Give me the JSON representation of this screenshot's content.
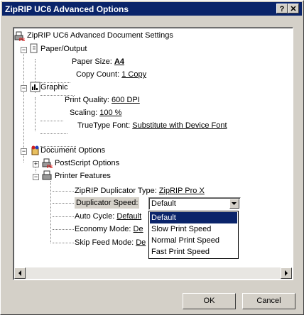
{
  "window": {
    "title": "ZipRIP UC6 Advanced Options"
  },
  "titlebar": {
    "help_label": "?",
    "close_label": "✕"
  },
  "tree": {
    "root": {
      "label": "ZipRIP UC6 Advanced Document Settings",
      "icon": "printer-settings-icon"
    },
    "paper_output": {
      "label": "Paper/Output",
      "icon": "paper-output-icon",
      "expander": "−",
      "paper_size_label": "Paper Size:",
      "paper_size_value": "A4",
      "copy_count_label": "Copy Count:",
      "copy_count_value": "1 Copy"
    },
    "graphic": {
      "label": "Graphic",
      "icon": "graphic-icon",
      "expander": "−",
      "print_quality_label": "Print Quality:",
      "print_quality_value": "600 DPI",
      "scaling_label": "Scaling:",
      "scaling_value": "100 %",
      "truetype_label": "TrueType Font:",
      "truetype_value": "Substitute with Device Font"
    },
    "document_options": {
      "label": "Document Options",
      "icon": "document-options-icon",
      "expander": "−",
      "postscript": {
        "label": "PostScript Options",
        "expander": "+"
      },
      "printer_features": {
        "label": "Printer Features",
        "expander": "−",
        "duplicator_type_label": "ZipRIP Duplicator Type:",
        "duplicator_type_value": "ZipRIP Pro X",
        "duplicator_speed_label": "Duplicator Speed:",
        "auto_cycle_label": "Auto Cycle:",
        "auto_cycle_value": "Default",
        "economy_mode_label": "Economy Mode:",
        "economy_mode_value": "De",
        "skip_feed_label": "Skip Feed Mode:",
        "skip_feed_value": "De"
      }
    }
  },
  "duplicator_speed_select": {
    "selected": "Default",
    "options": [
      "Default",
      "Slow Print Speed",
      "Normal Print Speed",
      "Fast Print Speed"
    ]
  },
  "buttons": {
    "ok": "OK",
    "cancel": "Cancel"
  },
  "colors": {
    "titlebar": "#0a246a",
    "face": "#d4d0c8",
    "highlight": "#0a246a"
  }
}
